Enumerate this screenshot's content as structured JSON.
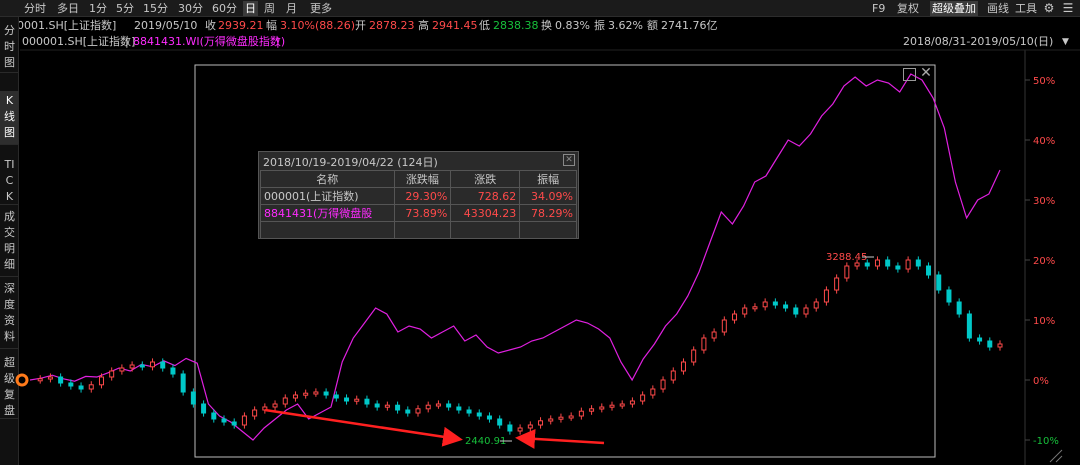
{
  "toolbar": {
    "periods": [
      "分时",
      "多日",
      "1分",
      "5分",
      "15分",
      "30分",
      "60分",
      "日",
      "周",
      "月",
      "更多"
    ],
    "active_period": "日",
    "right": {
      "f9": "F9",
      "fuquan": "复权",
      "overlay": "超级叠加",
      "draw": "画线",
      "tools": "工具"
    }
  },
  "quote": {
    "code": "000001.SH[上证指数]",
    "date": "2019/05/10",
    "close_label": "收",
    "close": "2939.21",
    "change_label": "幅",
    "change": "3.10%(88.26)",
    "open_label": "开",
    "open": "2878.23",
    "high_label": "高",
    "high": "2941.45",
    "low_label": "低",
    "low": "2838.38",
    "turnover_label": "换",
    "turnover": "0.83%",
    "amplitude_label": "振",
    "amplitude": "3.62%",
    "amount_label": "额",
    "amount": "2741.76亿"
  },
  "legend": {
    "main": "000001.SH[上证指数]",
    "separator": "|",
    "overlay": "8841431.WI(万得微盘股指数)",
    "overlay_tail": "|",
    "range": "2018/08/31-2019/05/10(日)"
  },
  "left_tabs": [
    {
      "label": "分时图"
    },
    {
      "label": "K线图"
    },
    {
      "label": "TICK"
    },
    {
      "label": "成交明细"
    },
    {
      "label": "深度资料"
    },
    {
      "label": "超级复盘"
    }
  ],
  "info_panel": {
    "title": "2018/10/19-2019/04/22 (124日)",
    "headers": [
      "名称",
      "涨跌幅",
      "涨跌",
      "振幅"
    ],
    "rows": [
      {
        "name": "000001(上证指数)",
        "pct": "29.30%",
        "chg": "728.62",
        "amp": "34.09%",
        "color": "#c8c8c8"
      },
      {
        "name": "8841431(万得微盘股",
        "pct": "73.89%",
        "chg": "43304.23",
        "amp": "78.29%",
        "color": "#ff2bff"
      }
    ]
  },
  "annotations": {
    "high_label": "3288.45",
    "low_label": "2440.91"
  },
  "colors": {
    "up": "#ff4a4a",
    "down": "#00c8c8",
    "overlay_line": "#e020e0",
    "arrow": "#ff2020"
  },
  "chart_data": {
    "type": "line",
    "y_axis_ticks": [
      "50%",
      "40%",
      "30%",
      "20%",
      "10%",
      "0%",
      "-10%"
    ],
    "ylim": [
      -10,
      52
    ],
    "series": [
      {
        "name": "8841431.WI(万得微盘股指数)",
        "values": [
          0,
          0.3,
          0.8,
          0.2,
          -0.2,
          0.6,
          0.5,
          1.2,
          2,
          1.5,
          2.6,
          2.2,
          3.2,
          2.4,
          3.6,
          2.8,
          -4,
          -6,
          -7,
          -8.5,
          -10,
          -8,
          -6.5,
          -5,
          -4,
          -6.5,
          -5.5,
          -4.5,
          3,
          7,
          9.5,
          12,
          11,
          8,
          9,
          8.5,
          7,
          8,
          9,
          6.5,
          7.5,
          5.5,
          4.5,
          5,
          5.5,
          6.5,
          7,
          8,
          9,
          10,
          9.5,
          8.5,
          7,
          3,
          0,
          3.5,
          6,
          9,
          11,
          14,
          18,
          23,
          28,
          26,
          29,
          33,
          34,
          37,
          40,
          39,
          41,
          44,
          46,
          49,
          50.5,
          49,
          50,
          49.5,
          48,
          51,
          50,
          47,
          42,
          33,
          27,
          30,
          31,
          35
        ]
      },
      {
        "name": "000001.SH[上证指数]",
        "values": [
          0,
          0.2,
          0.5,
          -0.5,
          -1,
          -1.5,
          -0.8,
          0.5,
          1.5,
          2,
          2.5,
          2.2,
          3,
          2,
          1,
          -2,
          -4,
          -5.5,
          -6.5,
          -7,
          -7.5,
          -6,
          -5,
          -4.5,
          -4,
          -3,
          -2.5,
          -2.2,
          -2,
          -2.5,
          -3,
          -3.5,
          -3.2,
          -4,
          -4.5,
          -4.2,
          -5,
          -5.5,
          -4.8,
          -4.2,
          -4,
          -4.5,
          -5,
          -5.5,
          -6,
          -6.5,
          -7.5,
          -8.5,
          -8,
          -7.5,
          -6.8,
          -6.5,
          -6.2,
          -6,
          -5.2,
          -4.8,
          -4.5,
          -4.2,
          -4,
          -3.5,
          -2.5,
          -1.5,
          0,
          1.5,
          3,
          5,
          7,
          8,
          10,
          11,
          12,
          12.2,
          13,
          12.5,
          12,
          11,
          12,
          13,
          15,
          17,
          19,
          19.5,
          19,
          20,
          19,
          18.5,
          20,
          19,
          17.5,
          15,
          13,
          11,
          7,
          6.5,
          5.5,
          6
        ]
      }
    ]
  }
}
